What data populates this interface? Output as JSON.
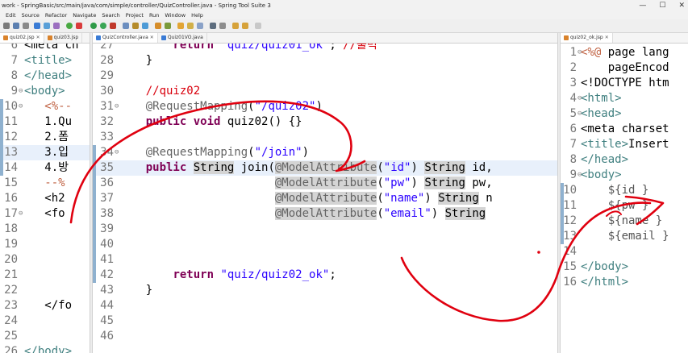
{
  "window": {
    "title": "work - SpringBasic/src/main/java/com/simple/controller/QuizController.java - Spring Tool Suite 3",
    "controls": [
      "—",
      "☐",
      "✕"
    ]
  },
  "menu": [
    "Edit",
    "Source",
    "Refactor",
    "Navigate",
    "Search",
    "Project",
    "Run",
    "Window",
    "Help"
  ],
  "left_editor": {
    "tabs": [
      {
        "label": "quiz02.jsp",
        "active": true,
        "close": "✕"
      },
      {
        "label": "quiz03.jsp",
        "active": false,
        "close": ""
      }
    ],
    "lines": [
      {
        "n": "6",
        "text": "<meta ch"
      },
      {
        "n": "7",
        "text": "<title>"
      },
      {
        "n": "8",
        "text": "</head>"
      },
      {
        "n": "9",
        "text": "<body>"
      },
      {
        "n": "10",
        "text": "   <%--"
      },
      {
        "n": "11",
        "text": "   1.Qu"
      },
      {
        "n": "12",
        "text": "   2.폼"
      },
      {
        "n": "13",
        "text": "   3.입"
      },
      {
        "n": "14",
        "text": "   4.방"
      },
      {
        "n": "15",
        "text": "   --%"
      },
      {
        "n": "16",
        "text": "   <h2"
      },
      {
        "n": "17",
        "text": "   <fo"
      },
      {
        "n": "18",
        "text": ""
      },
      {
        "n": "19",
        "text": ""
      },
      {
        "n": "20",
        "text": ""
      },
      {
        "n": "21",
        "text": ""
      },
      {
        "n": "22",
        "text": ""
      },
      {
        "n": "23",
        "text": "   </fo"
      },
      {
        "n": "24",
        "text": ""
      },
      {
        "n": "25",
        "text": ""
      },
      {
        "n": "26",
        "text": "</body>"
      }
    ]
  },
  "center_editor": {
    "tabs": [
      {
        "label": "QuizController.java",
        "active": true,
        "close": "✕"
      },
      {
        "label": "Quiz01VO.java",
        "active": false,
        "close": ""
      }
    ],
    "lines": [
      {
        "n": "27",
        "text": "        return \"quiz/quiz01_ok\"; //출력"
      },
      {
        "n": "28",
        "text": "    }"
      },
      {
        "n": "29",
        "text": ""
      },
      {
        "n": "30",
        "text": "    //quiz02"
      },
      {
        "n": "31",
        "text": "    @RequestMapping(\"/quiz02\")"
      },
      {
        "n": "32",
        "text": "    public void quiz02() {}"
      },
      {
        "n": "33",
        "text": ""
      },
      {
        "n": "34",
        "text": "    @RequestMapping(\"/join\")"
      },
      {
        "n": "35",
        "text": "    public String join(@ModelAttribute(\"id\") String id,"
      },
      {
        "n": "36",
        "text": "                       @ModelAttribute(\"pw\") String pw,"
      },
      {
        "n": "37",
        "text": "                       @ModelAttribute(\"name\") String n"
      },
      {
        "n": "38",
        "text": "                       @ModelAttribute(\"email\") String"
      },
      {
        "n": "39",
        "text": ""
      },
      {
        "n": "40",
        "text": ""
      },
      {
        "n": "41",
        "text": ""
      },
      {
        "n": "42",
        "text": "        return \"quiz/quiz02_ok\";"
      },
      {
        "n": "43",
        "text": "    }"
      },
      {
        "n": "44",
        "text": ""
      },
      {
        "n": "45",
        "text": ""
      },
      {
        "n": "46",
        "text": ""
      }
    ]
  },
  "right_editor": {
    "tabs": [
      {
        "label": "quiz02_ok.jsp",
        "active": true,
        "close": "✕"
      }
    ],
    "lines": [
      {
        "n": "1",
        "text": "<%@ page lang"
      },
      {
        "n": "2",
        "text": "    pageEncod"
      },
      {
        "n": "3",
        "text": "<!DOCTYPE htm"
      },
      {
        "n": "4",
        "text": "<html>"
      },
      {
        "n": "5",
        "text": "<head>"
      },
      {
        "n": "6",
        "text": "<meta charset"
      },
      {
        "n": "7",
        "text": "<title>Insert"
      },
      {
        "n": "8",
        "text": "</head>"
      },
      {
        "n": "9",
        "text": "<body>"
      },
      {
        "n": "10",
        "text": "    ${id }"
      },
      {
        "n": "11",
        "text": "    ${pw }"
      },
      {
        "n": "12",
        "text": "    ${name }"
      },
      {
        "n": "13",
        "text": "    ${email }"
      },
      {
        "n": "14",
        "text": ""
      },
      {
        "n": "15",
        "text": "</body>"
      },
      {
        "n": "16",
        "text": "</html>"
      }
    ]
  },
  "colors": {
    "keyword": "#7f0055",
    "string": "#2a00ff",
    "annotation": "#646464",
    "comment": "#d9000d",
    "annotation_ink": "#e0000f",
    "current_line": "#e8f0fb"
  }
}
